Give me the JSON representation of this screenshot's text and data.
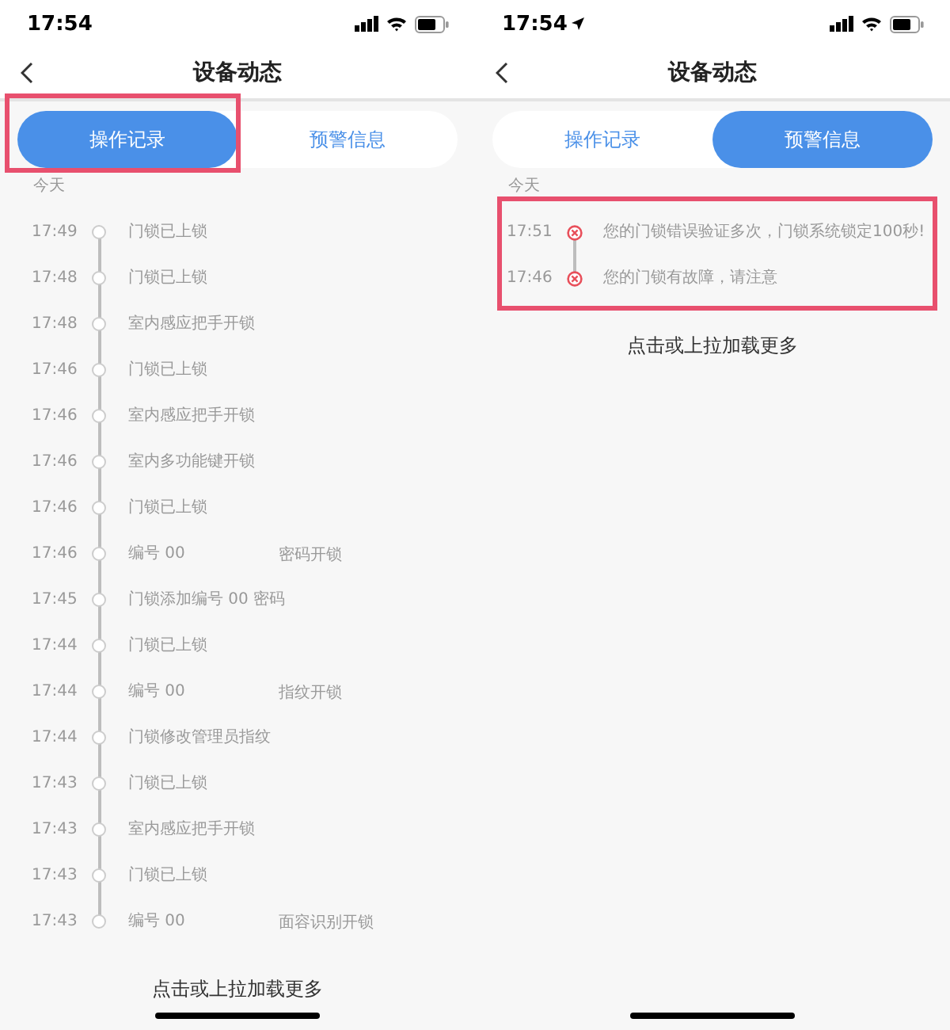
{
  "screens": [
    {
      "status_time": "17:54",
      "location_services": false,
      "title": "设备动态",
      "entries_highlighted": false,
      "tabs": [
        {
          "label": "操作记录",
          "selected": true,
          "highlighted": true
        },
        {
          "label": "预警信息",
          "selected": false,
          "highlighted": false
        }
      ],
      "date_label": "今天",
      "entries": [
        {
          "kind": "record",
          "time": "17:49",
          "text": "门锁已上锁"
        },
        {
          "kind": "record",
          "time": "17:48",
          "text": "门锁已上锁"
        },
        {
          "kind": "record",
          "time": "17:48",
          "text": "室内感应把手开锁"
        },
        {
          "kind": "record",
          "time": "17:46",
          "text": "门锁已上锁"
        },
        {
          "kind": "record",
          "time": "17:46",
          "text": "室内感应把手开锁"
        },
        {
          "kind": "record",
          "time": "17:46",
          "text": "室内多功能键开锁"
        },
        {
          "kind": "record",
          "time": "17:46",
          "text": "门锁已上锁"
        },
        {
          "kind": "record",
          "time": "17:46",
          "text": "编号 00",
          "detail": "密码开锁"
        },
        {
          "kind": "record",
          "time": "17:45",
          "text": "门锁添加编号 00 密码"
        },
        {
          "kind": "record",
          "time": "17:44",
          "text": "门锁已上锁"
        },
        {
          "kind": "record",
          "time": "17:44",
          "text": "编号 00",
          "detail": "指纹开锁"
        },
        {
          "kind": "record",
          "time": "17:44",
          "text": "门锁修改管理员指纹"
        },
        {
          "kind": "record",
          "time": "17:43",
          "text": "门锁已上锁"
        },
        {
          "kind": "record",
          "time": "17:43",
          "text": "室内感应把手开锁"
        },
        {
          "kind": "record",
          "time": "17:43",
          "text": "门锁已上锁"
        },
        {
          "kind": "record",
          "time": "17:43",
          "text": "编号 00",
          "detail": "面容识别开锁"
        }
      ],
      "load_more": "点击或上拉加载更多"
    },
    {
      "status_time": "17:54",
      "location_services": true,
      "title": "设备动态",
      "entries_highlighted": true,
      "tabs": [
        {
          "label": "操作记录",
          "selected": false,
          "highlighted": false
        },
        {
          "label": "预警信息",
          "selected": true,
          "highlighted": false
        }
      ],
      "date_label": "今天",
      "entries": [
        {
          "kind": "alert",
          "time": "17:51",
          "text": "您的门锁错误验证多次，门锁系统锁定100秒!"
        },
        {
          "kind": "alert",
          "time": "17:46",
          "text": "您的门锁有故障，请注意"
        }
      ],
      "load_more": "点击或上拉加载更多"
    }
  ]
}
